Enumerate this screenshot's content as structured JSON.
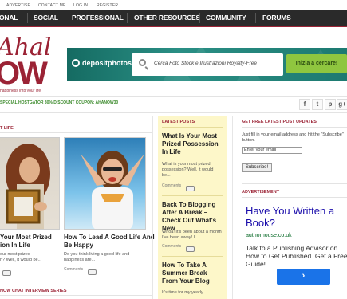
{
  "toplinks": [
    "ADVERTISE",
    "CONTACT ME",
    "LOG IN",
    "REGISTER"
  ],
  "nav": [
    "ONAL",
    "SOCIAL",
    "PROFESSIONAL",
    "OTHER RESOURCES",
    "COMMUNITY",
    "FORUMS"
  ],
  "logo": {
    "script": "Ahal",
    "main": "OW",
    "tagline": "happiness into your life"
  },
  "banner": {
    "brand": "depositphotos",
    "search_placeholder": "Cerca Foto Stock e Illustrazioni Royalty-Free",
    "button": "Inizia a cercare!"
  },
  "promo": "SPECIAL HOSTGATOR 30% DISCOUNT COUPON: AHANOW30",
  "social_icons": [
    "facebook-icon",
    "twitter-icon",
    "pinterest-icon",
    "google-plus-icon"
  ],
  "social_glyphs": [
    "f",
    "t",
    "p",
    "g+"
  ],
  "left": {
    "section": "T LIFE",
    "articles": [
      {
        "title": "Your Most Prized\nion In Life",
        "excerpt": "our most prized\nn? Well, it would be...",
        "comments": ""
      },
      {
        "title": "How To Lead A Good Life And\nBe Happy",
        "excerpt": "Do you think living a good life and\nhappiness are...",
        "comments_label": "Comments",
        "comments": ""
      }
    ],
    "bottom_section": "NOW CHAT INTERVIEW SERIES"
  },
  "latest": {
    "section": "LATEST POSTS",
    "posts": [
      {
        "title": "What Is Your Most Prized Possession In Life",
        "excerpt": "What is your most prized possession? Well, it would be...",
        "comments_label": "Comments"
      },
      {
        "title": "Back To Blogging After A Break – Check Out What's New",
        "excerpt": "Whoa! It's been about a month I've been away! I...",
        "comments_label": "Comments"
      },
      {
        "title": "How To Take A Summer Break From Your Blog",
        "excerpt": "It's time for my yearly"
      }
    ]
  },
  "right": {
    "updates_section": "GET FREE LATEST POST UPDATES",
    "updates_text": "Just fill in your email address and hit the \"Subscribe\" button.",
    "email_value": "Enter your email",
    "subscribe": "Subscribe!",
    "ad_section": "ADVERTISEMENT",
    "ad_title": "Have You Written a Book?",
    "ad_url": "authorhouse.co.uk",
    "ad_body": "Talk to a Publishing Advisor on How to Get Published. Get a Free Guide!",
    "ad_button": "›"
  },
  "colors": {
    "brand": "#9b2335",
    "nav": "#2a2a2a",
    "banner": "#1d7a71",
    "cta": "#8fc63f",
    "latest_bg": "#fdf7c9",
    "ad_link": "#1a0dab"
  }
}
